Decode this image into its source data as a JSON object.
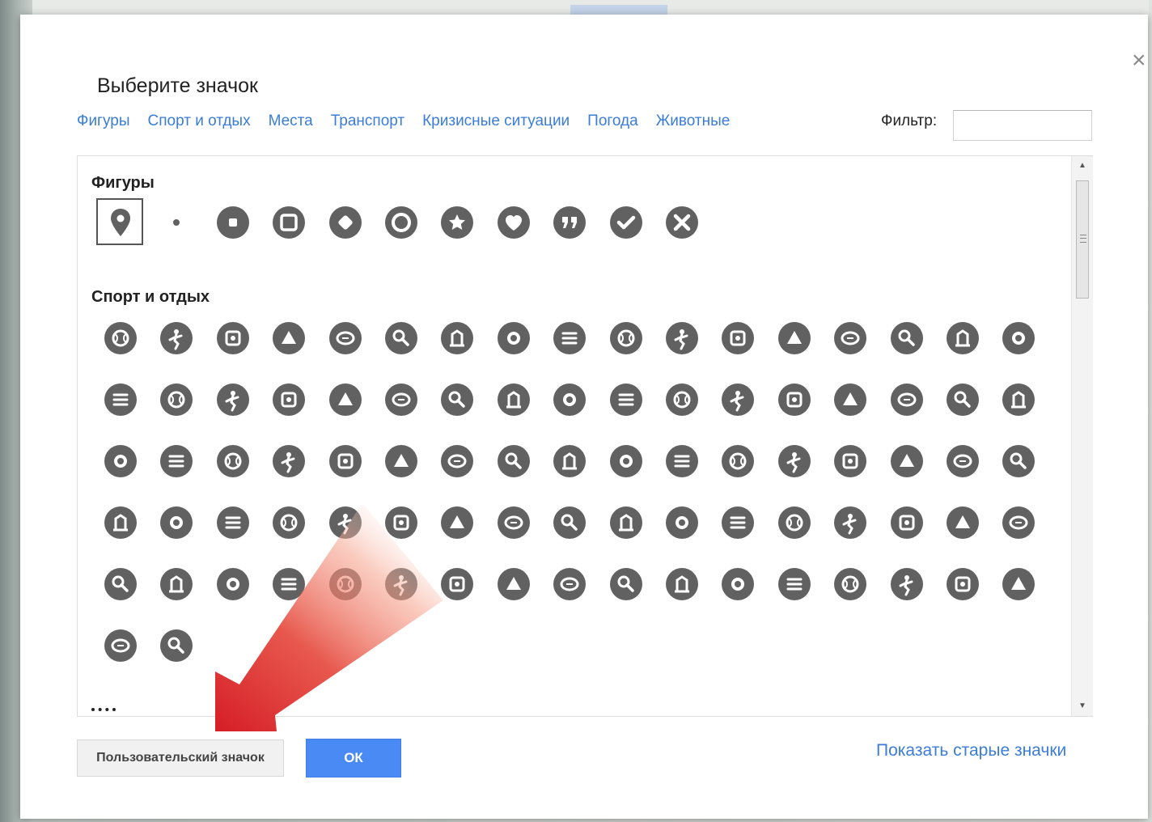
{
  "dialog": {
    "title": "Выберите значок",
    "close_glyph": "×",
    "tabs": [
      "Фигуры",
      "Спорт и отдых",
      "Места",
      "Транспорт",
      "Кризисные ситуации",
      "Погода",
      "Животные"
    ],
    "filter": {
      "label": "Фильтр:",
      "value": "",
      "placeholder": ""
    }
  },
  "sections": {
    "shapes": {
      "title": "Фигуры",
      "icons": [
        "placemark-icon",
        "small-dot-icon",
        "square-dot-icon",
        "square-icon",
        "diamond-icon",
        "ring-icon",
        "star-icon",
        "heart-icon",
        "quote-icon",
        "checkmark-icon",
        "cross-icon"
      ],
      "selected_index": 0
    },
    "sports": {
      "title": "Спорт и отдых",
      "icons": [
        "baseball-icon",
        "basketball-icon",
        "football-icon",
        "soccer-icon",
        "rugby-ball-icon",
        "volleyball-icon",
        "golfer-icon",
        "golf-course-icon",
        "magnifier-icon",
        "golf-flag-icon",
        "badminton-icon",
        "tennis-racket-icon",
        "table-tennis-icon",
        "boxing-glove-icon",
        "martial-arts-icon",
        "fencing-icon",
        "weightlifting-icon",
        "race-flag-icon",
        "surfing-icon",
        "horse-riding-icon",
        "bowling-icon",
        "billiards-icon",
        "cricket-icon",
        "archery-icon",
        "running-icon",
        "nordic-walking-icon",
        "cycling-icon",
        "dancing-icon",
        "climbing-wall-icon",
        "climbing-icon",
        "parkour-icon",
        "frisbee-icon",
        "gymnastics-icon",
        "paragliding-icon",
        "skydiving-icon",
        "hockey-icon",
        "ice-skate-icon",
        "skiing-icon",
        "cross-country-ski-icon",
        "snowboard-icon",
        "sledding-icon",
        "ski-jump-icon",
        "ski-hiking-icon",
        "snowmobile-icon",
        "kayak-icon",
        "rowing-icon",
        "sailing-icon",
        "jet-ski-icon",
        "swimming-icon",
        "water-ski-icon",
        "diving-icon",
        "swim-pool-icon",
        "snorkel-mask-icon",
        "scuba-icon",
        "fish-icon",
        "fishing-icon",
        "gym-icon",
        "playground-icon",
        "picnic-table-icon",
        "pine-tree-icon",
        "deciduous-tree-icon",
        "palm-tree-icon",
        "mountains-icon",
        "volcano-icon",
        "hot-spring-icon",
        "waterfall-icon",
        "favorite-star-icon",
        "hiking-icon",
        "trekking-icon",
        "family-walk-icon",
        "sign-post-icon",
        "deer-icon",
        "hunting-icon",
        "shooting-icon",
        "telescope-icon",
        "binoculars-icon",
        "camping-tent-icon",
        "guitar-icon",
        "campfire-icon",
        "barbecue-icon",
        "axe-icon",
        "caravan-icon",
        "motorcycle-icon",
        "rv-icon",
        "trailer-icon",
        "cinema-icon",
        "acrobat-icon"
      ]
    }
  },
  "buttons": {
    "custom_icon": "Пользовательский значок",
    "ok": "ОК",
    "show_old_icons": "Показать старые значки"
  },
  "colors": {
    "icon": "#616161",
    "link": "#3b7dd8",
    "ok": "#4a8af4",
    "arrow": "#d9242a"
  }
}
